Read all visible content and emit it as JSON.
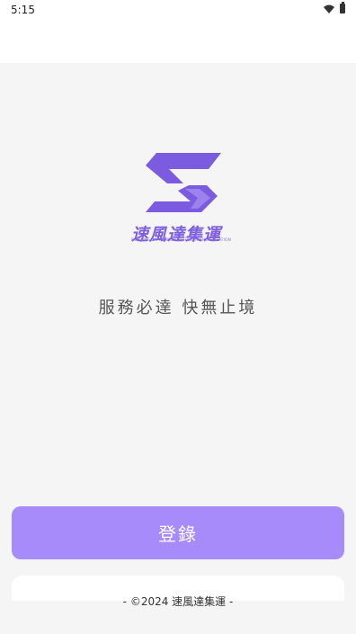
{
  "status_bar": {
    "time": "5:15",
    "wifi_icon": "wifi-icon",
    "battery_icon": "battery-icon"
  },
  "logo": {
    "icon": "company-s-arrow-logo",
    "name": "速風達集運",
    "subtitle": "SU FONG DA CONCENTRATED TRANSPORTATION",
    "brand_color": "#7e5fe0"
  },
  "slogan": "服務必達 快無止境",
  "login_button": {
    "label": "登錄",
    "color": "#a78bfa"
  },
  "footer": "- ©2024 速風達集運 -"
}
